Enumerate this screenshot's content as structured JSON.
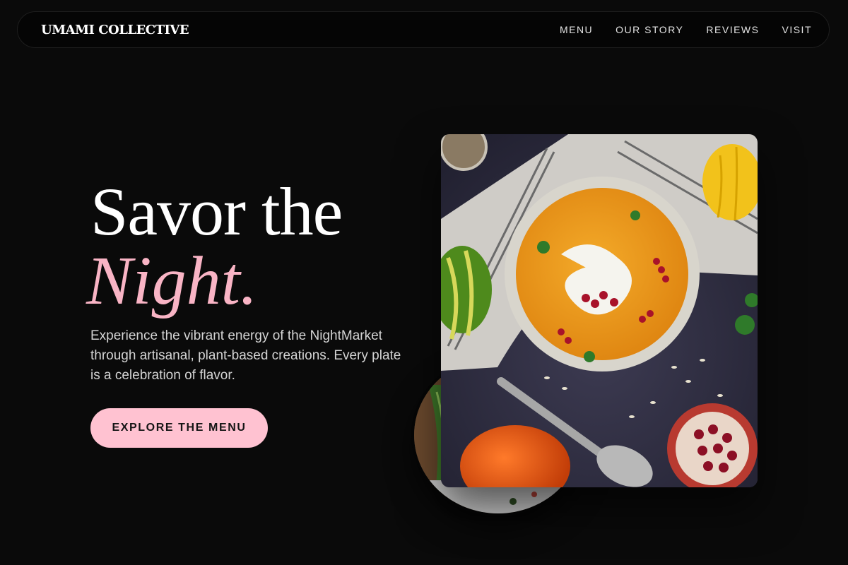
{
  "nav": {
    "brand": "UMAMI COLLECTIVE",
    "links": [
      "MENU",
      "OUR STORY",
      "REVIEWS",
      "VISIT"
    ]
  },
  "hero": {
    "title_line1": "Savor the",
    "title_line2": "Night.",
    "description": "Experience the vibrant energy of the NightMarket through artisanal, plant-based creations. Every plate is a celebration of flavor.",
    "cta_label": "EXPLORE THE MENU"
  },
  "colors": {
    "background": "#0a0a0a",
    "accent_pink": "#f9b4c5",
    "button_pink": "#ffc2d1",
    "text_primary": "#ffffff",
    "text_secondary": "#d4d4d4"
  },
  "icons": {
    "main_photo": "pumpkin-soup-bowl-photo",
    "secondary_photo": "vegetable-plate-photo"
  }
}
